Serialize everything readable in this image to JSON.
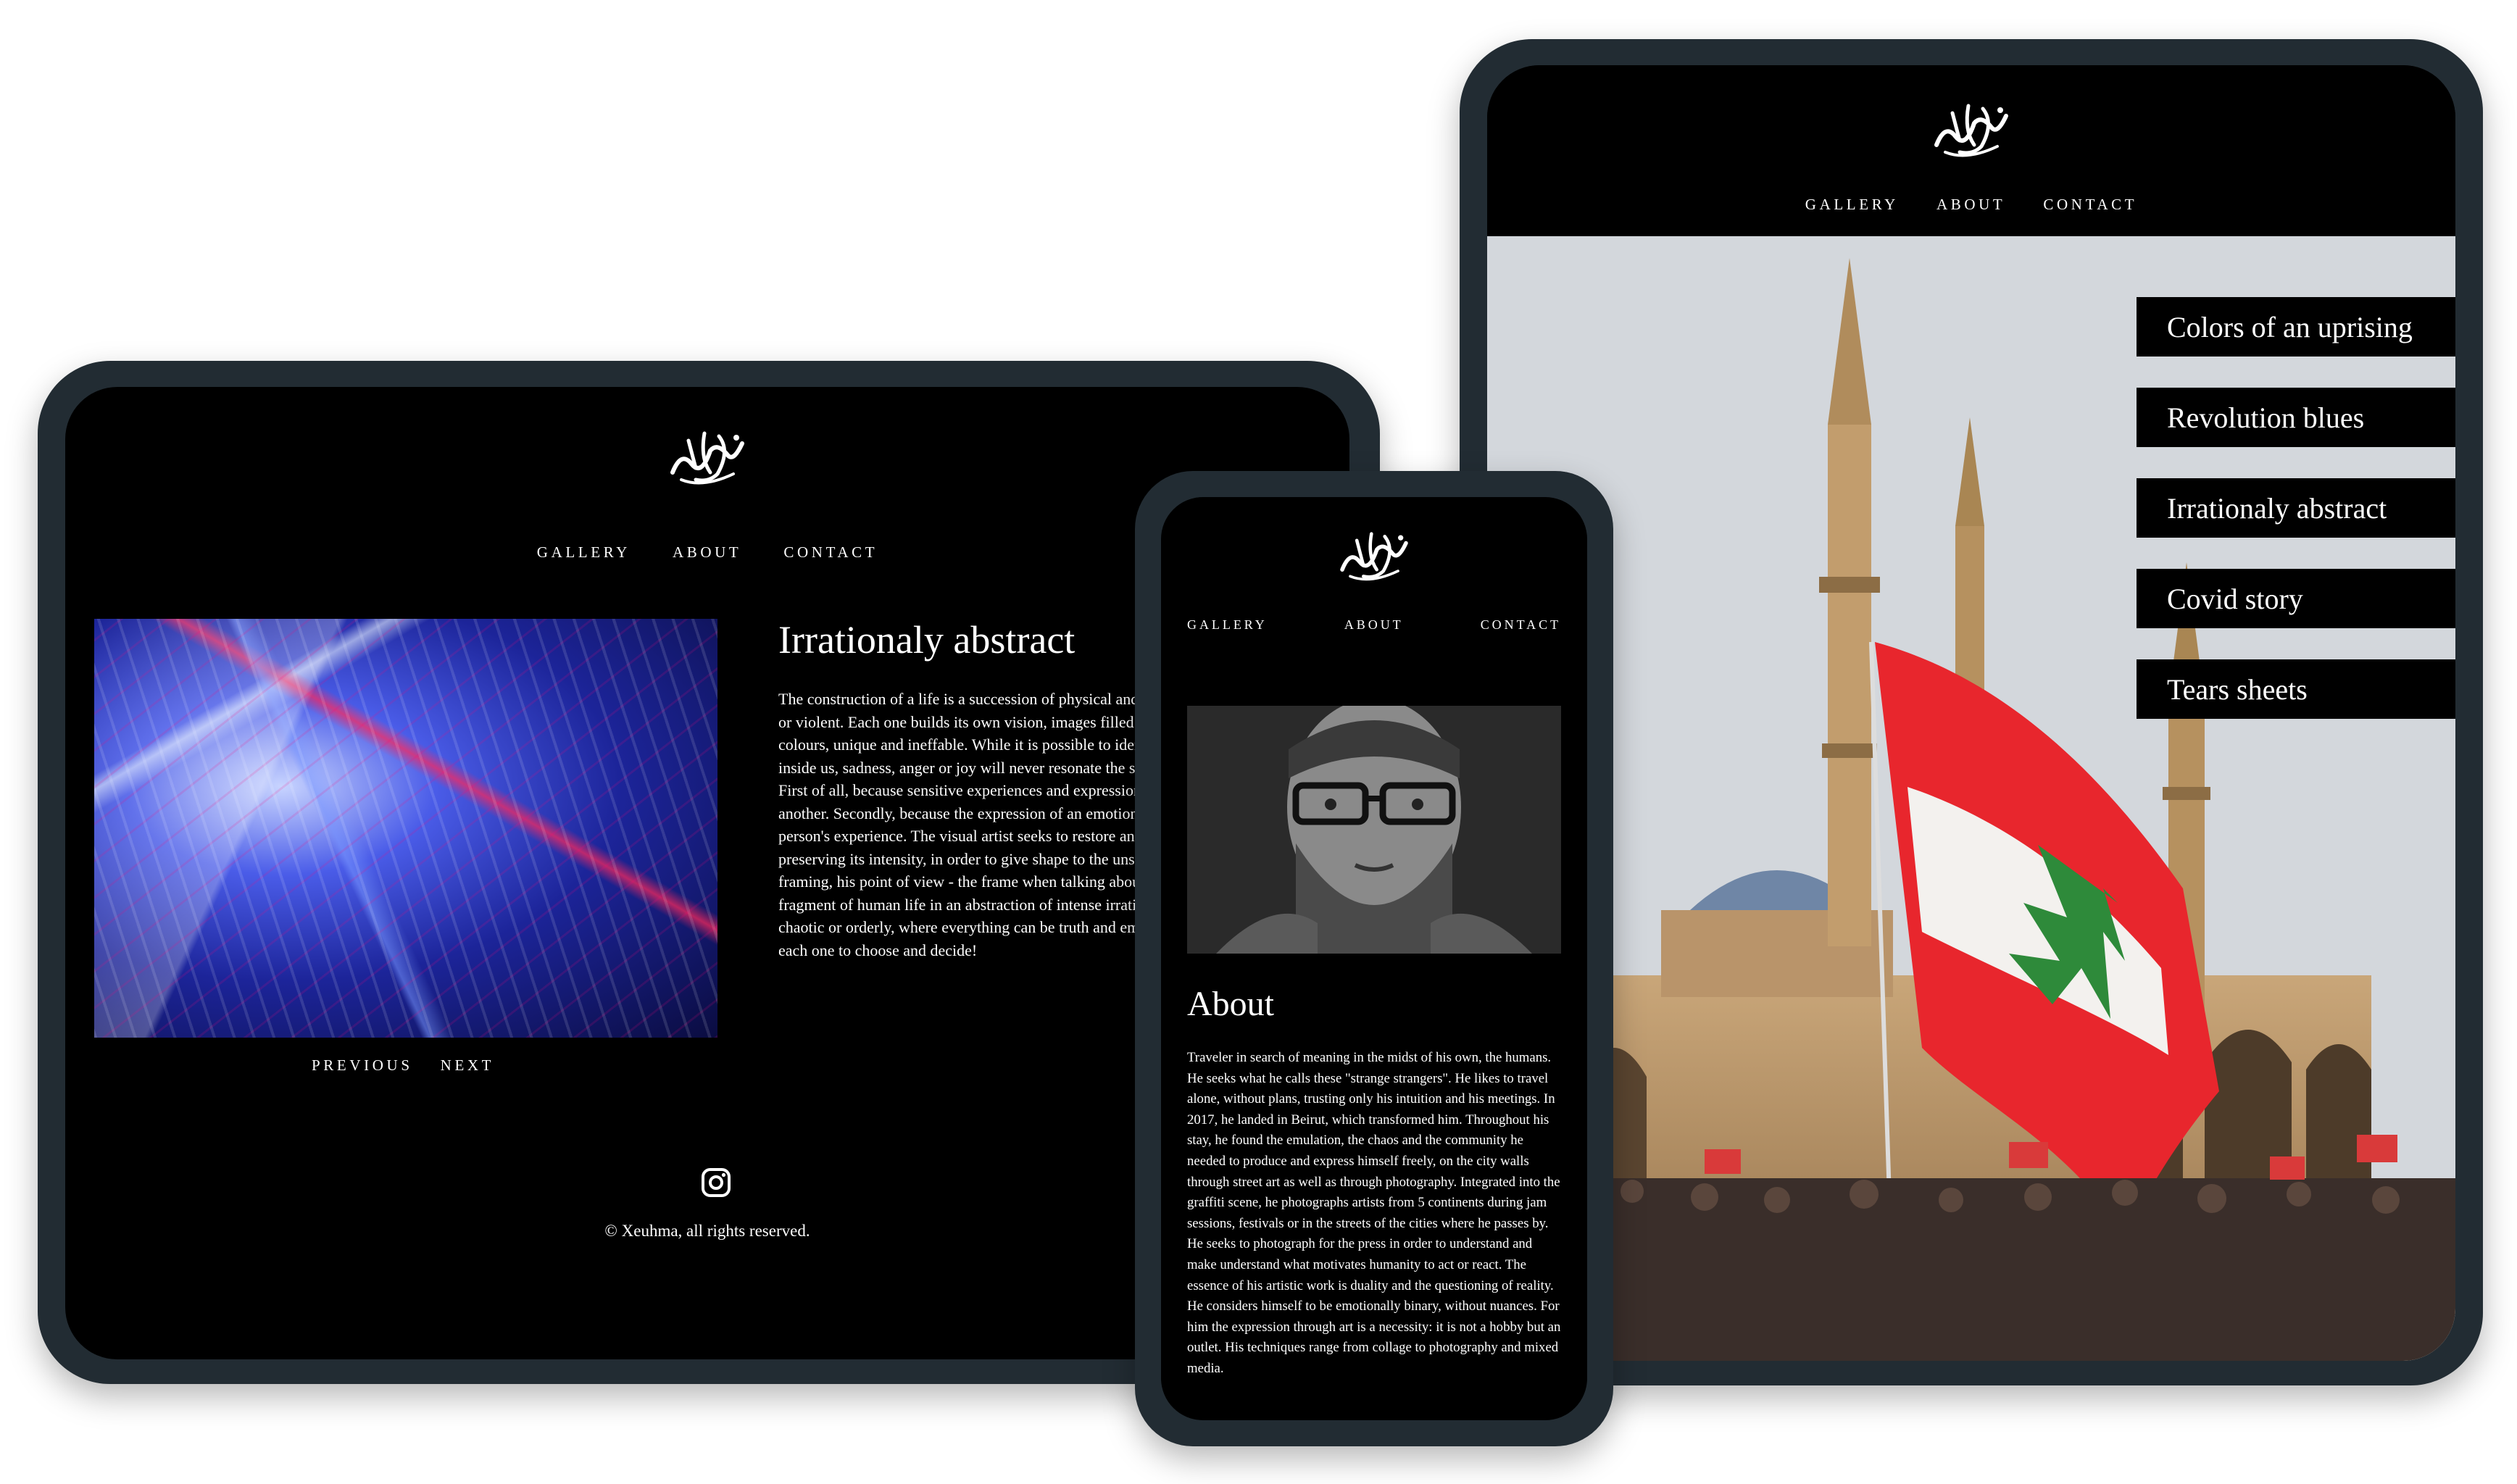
{
  "brand": {
    "logo_text": "Xeuhma"
  },
  "nav": {
    "gallery": "Gallery",
    "about": "About",
    "contact": "Contact"
  },
  "laptop": {
    "title": "Irrationaly abstract",
    "paragraph_1": "The construction of a life is a succession of physical and emotional experiences - subtle or violent. Each one builds its own vision, images filled with very personal shapes and colours, unique and ineffable. While it is possible to identify an emotion, what goes on inside us, sadness, anger or joy will never resonate the same from one person to another.",
    "paragraph_2": "First of all, because sensitive experiences and expression vary from one individual to another. Secondly, because the expression of an emotion varies according to each person's experience. The visual artist seeks to restore an emotion or an event, while preserving its intensity, in order to give shape to the unspeakable. By his choice, his framing, his point of view - the frame when talking about photography - he places a fragment of human life in an abstraction of intense irrationality. Simple or complex, chaotic or orderly, where everything can be truth and emotion, or simply reality. It's up to each one to choose and decide!",
    "previous": "Previous",
    "next": "Next",
    "copyright": "© Xeuhma, all rights reserved.",
    "art_alt_icon": "abstract-art-image"
  },
  "tablet": {
    "menu": [
      "Colors of an uprising",
      "Revolution blues",
      "Irrationaly abstract",
      "Covid story",
      "Tears sheets"
    ]
  },
  "phone": {
    "title": "About",
    "paragraph": "Traveler in search of meaning in the midst of his own, the humans. He seeks what he calls these \"strange strangers\". He likes to travel alone, without plans, trusting only his intuition and his meetings. In 2017, he landed in Beirut, which transformed him. Throughout his stay, he found the emulation, the chaos and the community he needed to produce and express himself freely, on the city walls through street art as well as through photography. Integrated into the graffiti scene, he photographs artists from 5 continents during jam sessions, festivals or in the streets of the cities where he passes by. He seeks to photograph for the press in order to understand and make understand what motivates humanity to act or react. The essence of his artistic work is duality and the questioning of reality. He considers himself to be emotionally binary, without nuances. For him the expression through art is a necessity: it is not a hobby but an outlet. His techniques range from collage to photography and mixed media."
  },
  "colors": {
    "device_frame": "#222c33",
    "screen": "#000000",
    "flag_red": "#e8262d",
    "flag_green": "#2e8a3a"
  }
}
